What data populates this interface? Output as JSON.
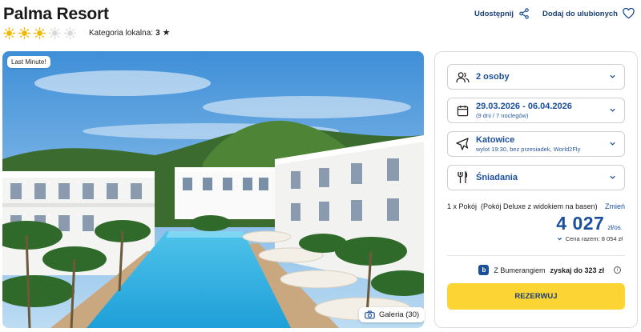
{
  "hotel": {
    "name": "Palma Resort",
    "stars": 3,
    "stars_max": 5,
    "category_label": "Kategoria lokalna:",
    "category_value": "3"
  },
  "actions": {
    "share_label": "Udostępnij",
    "favorite_label": "Dodaj do ulubionych"
  },
  "photo": {
    "badge": "Last Minute!",
    "gallery_label": "Galeria (30)"
  },
  "booking": {
    "people": "2 osoby",
    "dates": "29.03.2026 - 06.04.2026",
    "dates_sub": "(9 dni / 7 noclegów)",
    "departure": "Katowice",
    "departure_sub": "wylot 19:30, bez przesiadek, World2Fly",
    "board": "Śniadania",
    "room": "1 x Pokój  (Pokój Deluxe z widokiem na basen)",
    "change_label": "Zmień",
    "price": "4 027",
    "price_unit": "zł/os.",
    "total": "Cena razem: 8 054 zł",
    "boomerang_prefix": "Z Bumerangiem",
    "boomerang_bold": "zyskaj do 323 zł",
    "reserve_label": "REZERWUJ"
  },
  "colors": {
    "brand_blue": "#1b4f9c",
    "cta_yellow": "#fcd433",
    "star_gold": "#f2b800"
  }
}
